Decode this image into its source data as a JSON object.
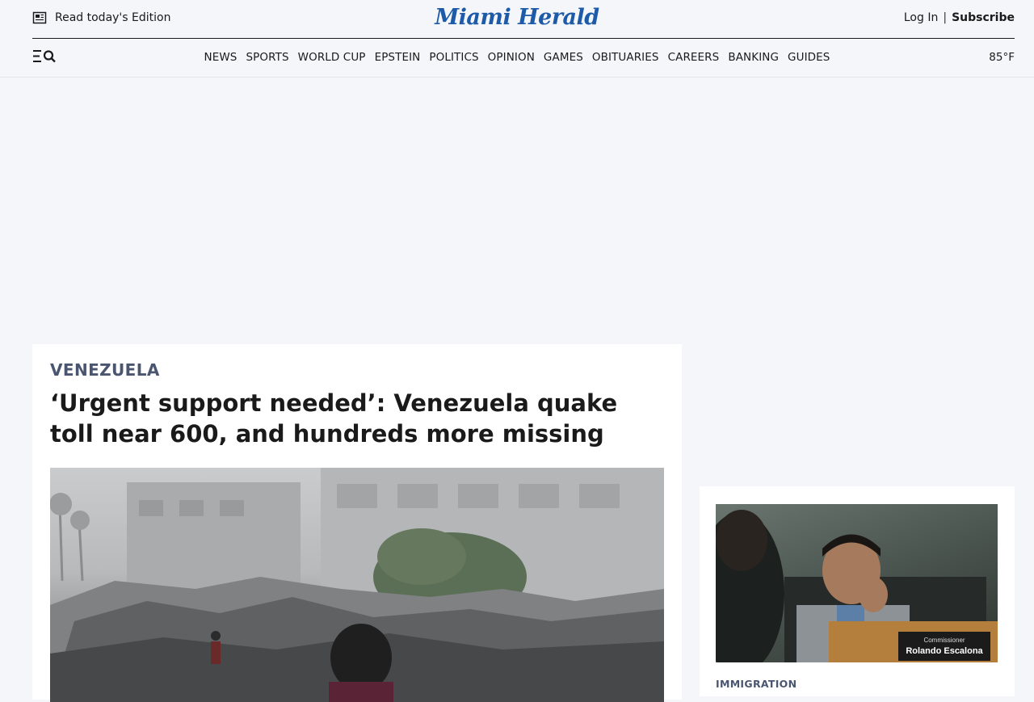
{
  "header": {
    "edition_label": "Read today's Edition",
    "logo_text": "Miami Herald",
    "login_label": "Log In",
    "separator": "|",
    "subscribe_label": "Subscribe",
    "temperature": "85°F"
  },
  "nav": {
    "items": [
      "NEWS",
      "SPORTS",
      "WORLD CUP",
      "EPSTEIN",
      "POLITICS",
      "OPINION",
      "GAMES",
      "OBITUARIES",
      "CAREERS",
      "BANKING",
      "GUIDES"
    ]
  },
  "lead_story": {
    "kicker": "VENEZUELA",
    "headline": "‘Urgent support needed’: Venezuela quake toll near 600, and hundreds more missing"
  },
  "side_story": {
    "nameplate_title": "Commissioner",
    "nameplate_name": "Rolando Escalona",
    "kicker": "IMMIGRATION"
  },
  "colors": {
    "brand_blue": "#1d5aa8",
    "kicker_slate": "#4a5570",
    "page_bg": "#f5f6fa"
  },
  "icons": {
    "edition": "newspaper-icon",
    "menu": "menu-search-icon"
  }
}
